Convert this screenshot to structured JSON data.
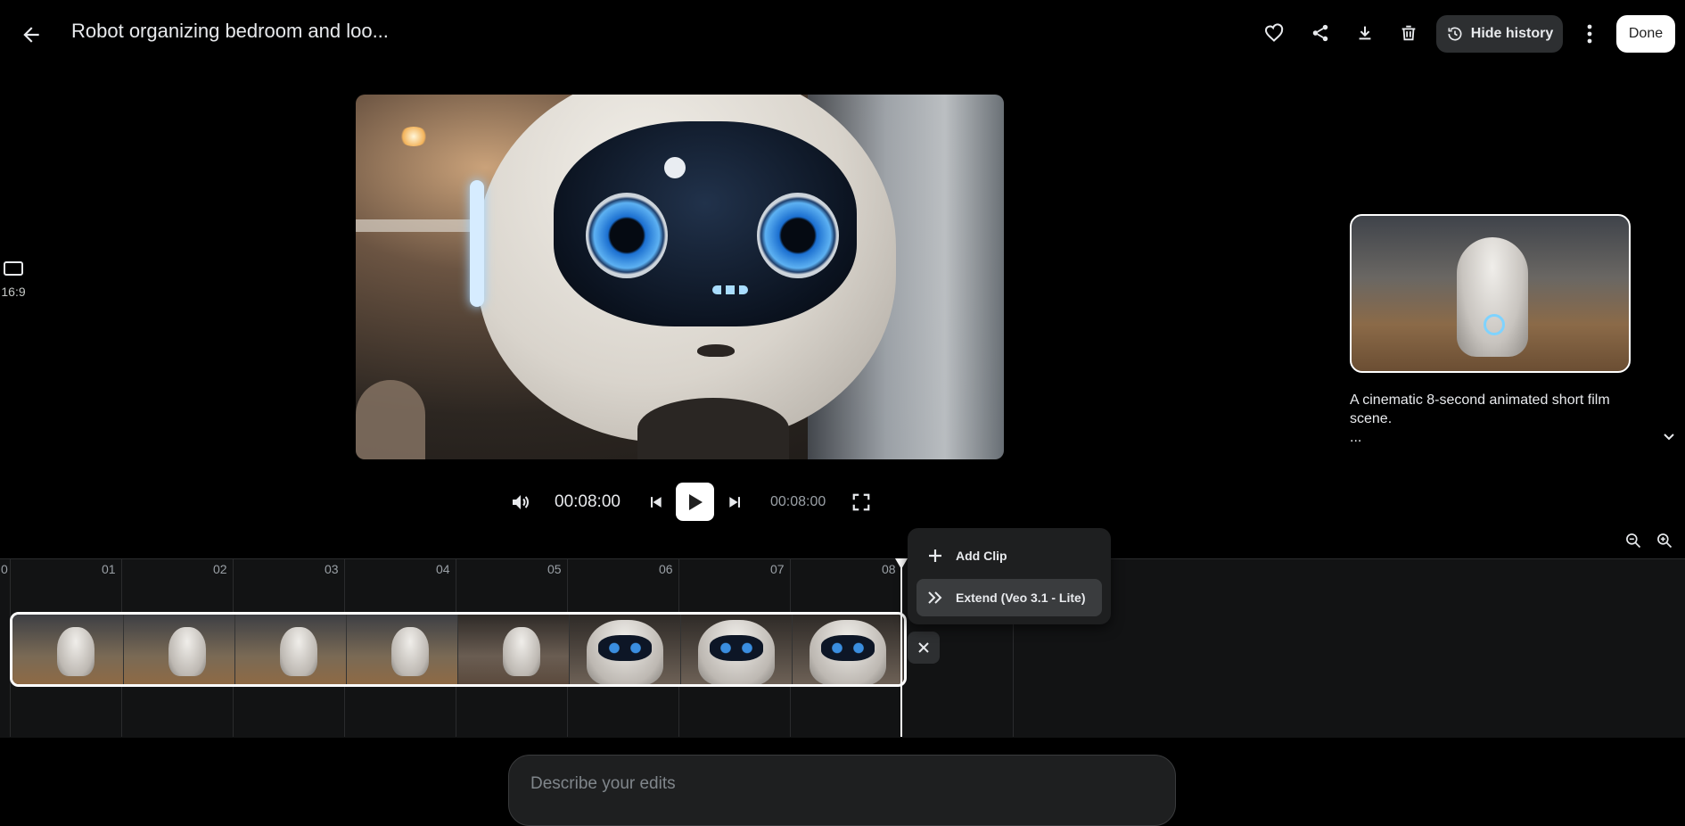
{
  "header": {
    "title": "Robot organizing bedroom and loo...",
    "hide_history_label": "Hide history",
    "done_label": "Done"
  },
  "aspect": {
    "label": "16:9"
  },
  "player": {
    "current_time": "00:08:00",
    "total_time": "00:08:00"
  },
  "history": {
    "description_line1": "A cinematic 8-second animated short film",
    "description_line2": "scene.",
    "description_more": "..."
  },
  "timeline": {
    "tick_labels": [
      "0",
      "01",
      "02",
      "03",
      "04",
      "05",
      "06",
      "07",
      "08"
    ],
    "menu": {
      "add_clip_label": "Add Clip",
      "extend_label": "Extend (Veo 3.1 - Lite)"
    }
  },
  "prompt": {
    "placeholder": "Describe your edits"
  },
  "colors": {
    "background": "#000000",
    "panel": "#1e1f20",
    "accent": "#ffffff"
  }
}
